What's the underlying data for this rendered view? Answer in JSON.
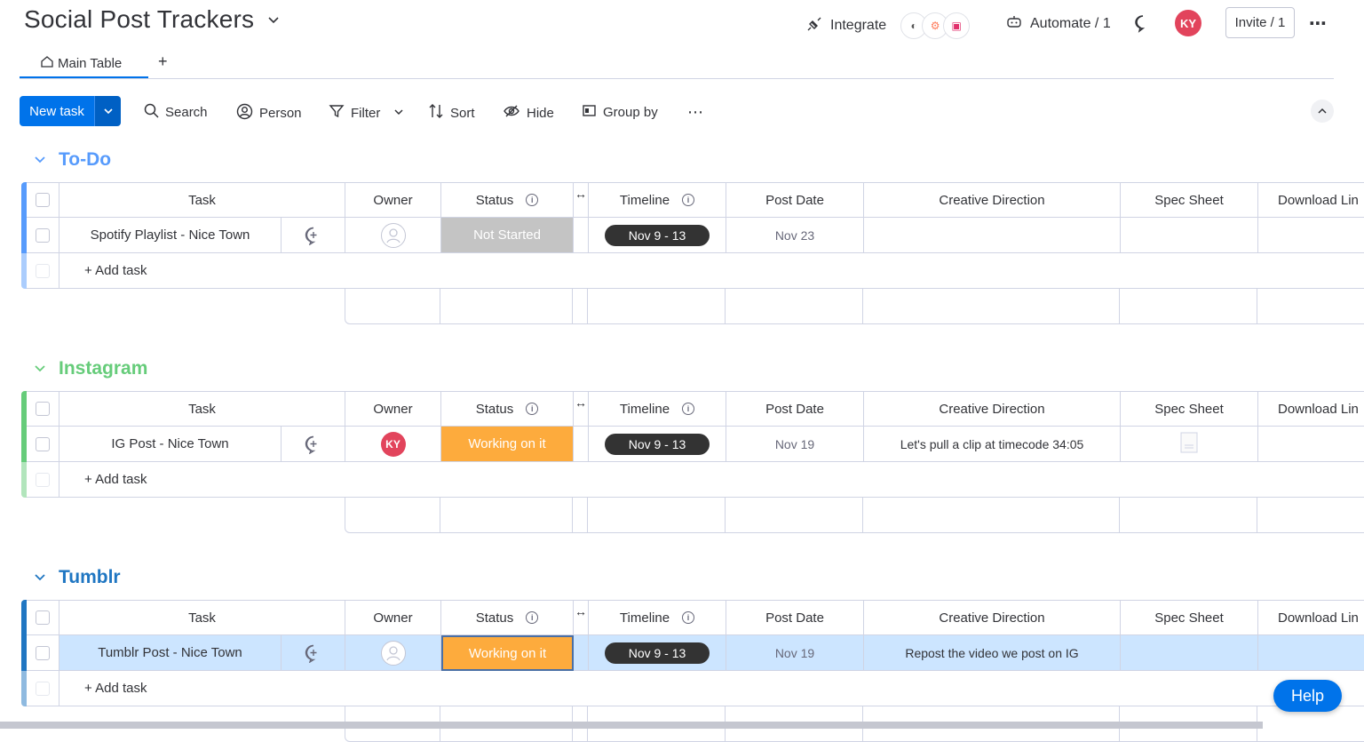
{
  "header": {
    "title": "Social Post Trackers",
    "integrate_label": "Integrate",
    "automate_label": "Automate / 1",
    "user_initials": "KY",
    "invite_label": "Invite / 1"
  },
  "tabs": [
    {
      "label": "Main Table"
    }
  ],
  "toolbar": {
    "new_task_label": "New task",
    "search_label": "Search",
    "person_label": "Person",
    "filter_label": "Filter",
    "sort_label": "Sort",
    "hide_label": "Hide",
    "group_by_label": "Group by"
  },
  "columns": [
    "Task",
    "Owner",
    "Status",
    "Timeline",
    "Post Date",
    "Creative Direction",
    "Spec Sheet",
    "Download Lin"
  ],
  "add_task_label": "+ Add task",
  "groups": [
    {
      "name": "To-Do",
      "color": "#579bfc",
      "rows": [
        {
          "task": "Spotify Playlist - Nice Town",
          "owner": "",
          "status": "Not Started",
          "status_color": "#c4c4c4",
          "timeline": "Nov 9 - 13",
          "post_date": "Nov 23",
          "creative_direction": "",
          "spec_sheet": "",
          "download": ""
        }
      ]
    },
    {
      "name": "Instagram",
      "color": "#66cc7a",
      "rows": [
        {
          "task": "IG Post - Nice Town",
          "owner": "KY",
          "status": "Working on it",
          "status_color": "#fdab3d",
          "timeline": "Nov 9 - 13",
          "post_date": "Nov 19",
          "creative_direction": "Let's pull a clip at timecode 34:05",
          "spec_sheet": "file-icon",
          "download": ""
        }
      ]
    },
    {
      "name": "Tumblr",
      "color": "#1f76c2",
      "rows": [
        {
          "task": "Tumblr Post - Nice Town",
          "owner": "",
          "status": "Working on it",
          "status_color": "#fdab3d",
          "timeline": "Nov 9 - 13",
          "post_date": "Nov 19",
          "creative_direction": "Repost the video we post on IG",
          "spec_sheet": "",
          "download": "",
          "selected": true
        }
      ]
    }
  ],
  "help_label": "Help",
  "colors": {
    "primary": "#0073ea",
    "selected_row": "#cce5ff"
  }
}
